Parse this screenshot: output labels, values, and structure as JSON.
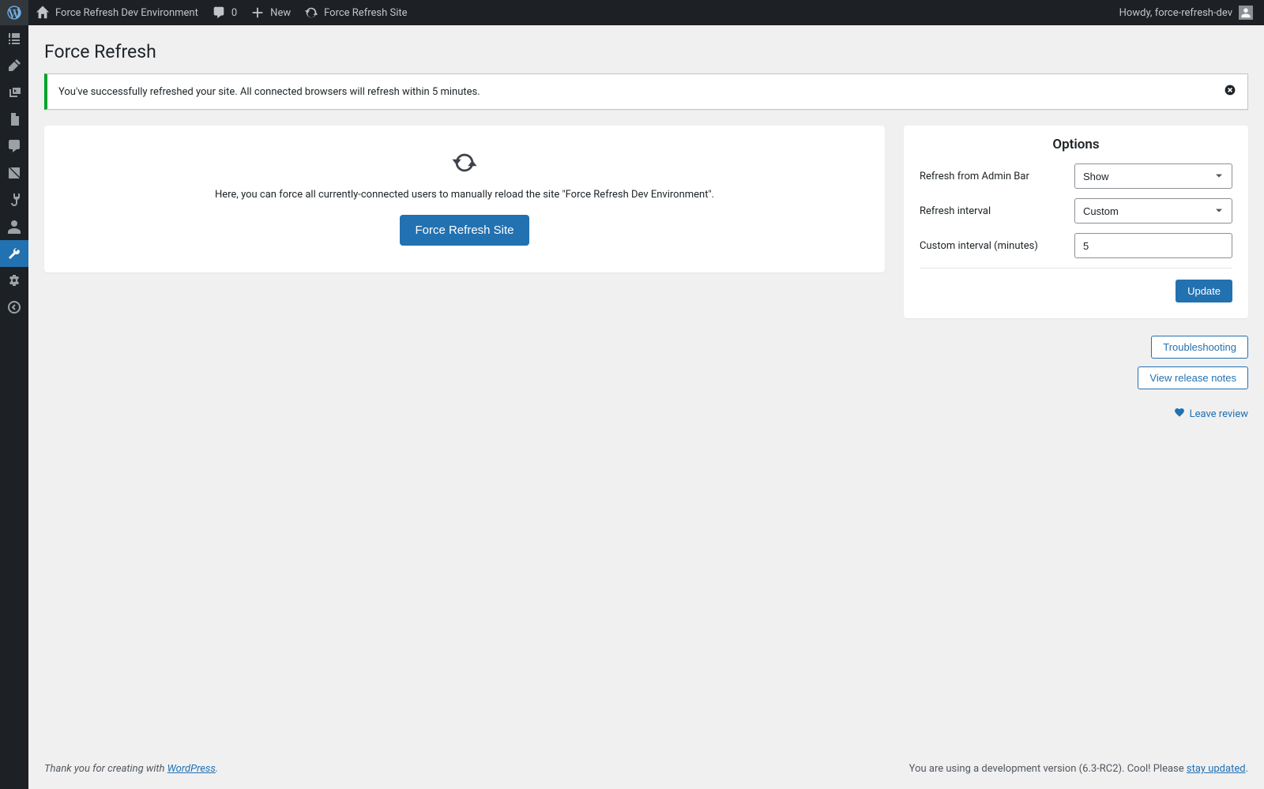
{
  "adminbar": {
    "site_name": "Force Refresh Dev Environment",
    "comments_count": "0",
    "new_label": "New",
    "force_refresh_label": "Force Refresh Site",
    "howdy_prefix": "Howdy, ",
    "username": "force-refresh-dev"
  },
  "page": {
    "title": "Force Refresh"
  },
  "notice": {
    "text": "You've successfully refreshed your site. All connected browsers will refresh within 5 minutes."
  },
  "main": {
    "description": "Here, you can force all currently-connected users to manually reload the site \"Force Refresh Dev Environment\".",
    "button_label": "Force Refresh Site"
  },
  "options": {
    "title": "Options",
    "rows": {
      "admin_bar": {
        "label": "Refresh from Admin Bar",
        "value": "Show"
      },
      "interval": {
        "label": "Refresh interval",
        "value": "Custom"
      },
      "custom": {
        "label": "Custom interval (minutes)",
        "value": "5"
      }
    },
    "update_label": "Update"
  },
  "side_links": {
    "troubleshooting": "Troubleshooting",
    "release_notes": "View release notes",
    "leave_review": "Leave review"
  },
  "footer": {
    "thanks_prefix": "Thank you for creating with ",
    "wordpress": "WordPress",
    "thanks_suffix": ".",
    "version_prefix": "You are using a development version (6.3-RC2). Cool! Please ",
    "stay_updated": "stay updated",
    "version_suffix": "."
  }
}
